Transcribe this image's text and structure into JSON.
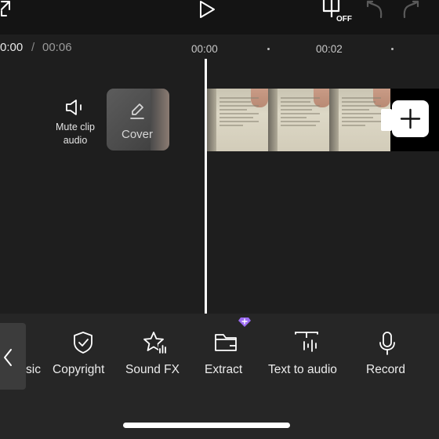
{
  "timeline": {
    "current_time": "0:00",
    "separator": "/",
    "total_time": "00:06",
    "ticks": [
      "00:00",
      "00:02"
    ]
  },
  "tracks": {
    "mute_label": "Mute clip\naudio",
    "cover_label": "Cover"
  },
  "toolbar": {
    "tools": [
      {
        "label": "sic",
        "icon": "music-icon"
      },
      {
        "label": "Copyright",
        "icon": "shield-check-icon"
      },
      {
        "label": "Sound FX",
        "icon": "star-sound-icon"
      },
      {
        "label": "Extract",
        "icon": "folder-icon"
      },
      {
        "label": "Text to audio",
        "icon": "text-audio-icon"
      },
      {
        "label": "Record",
        "icon": "microphone-icon"
      }
    ]
  },
  "colors": {
    "background": "#1e1e1e",
    "toolbar": "#262626",
    "premium_badge": "#9b6bf2"
  }
}
